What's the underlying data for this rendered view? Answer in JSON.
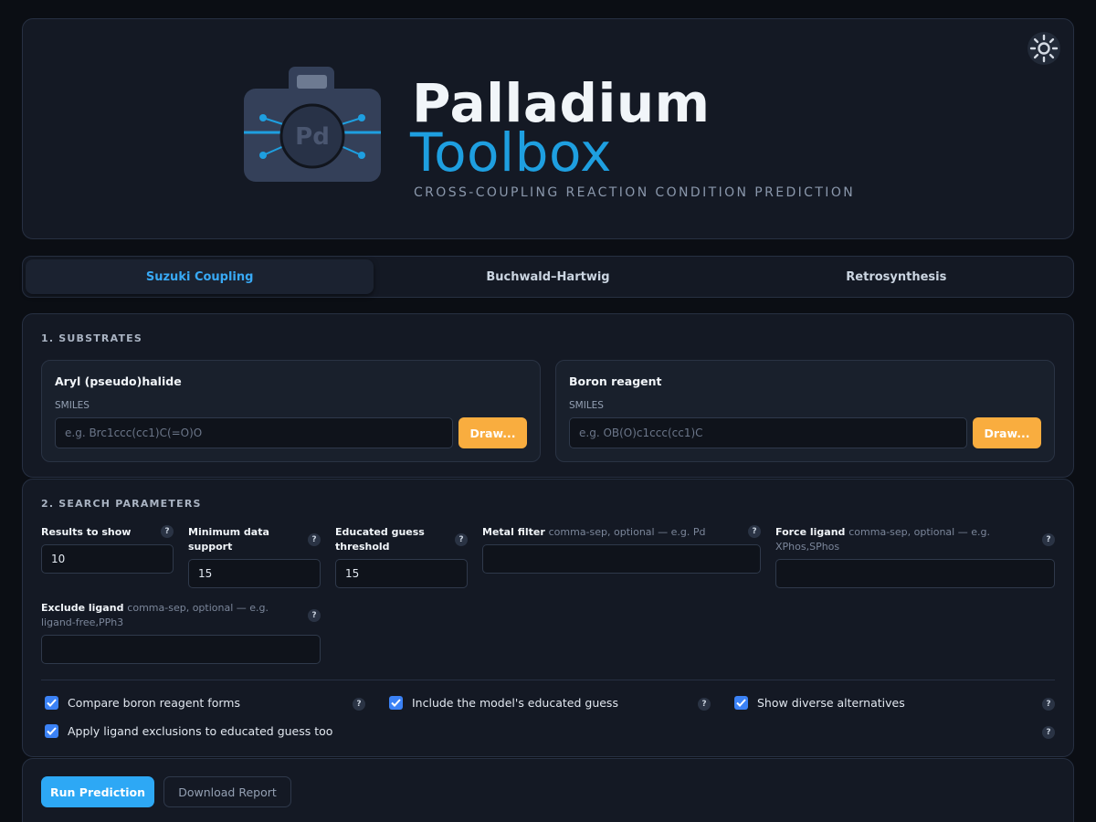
{
  "header": {
    "title_line1": "Palladium",
    "title_line2": "Toolbox",
    "subtitle": "CROSS-COUPLING REACTION CONDITION PREDICTION",
    "logo_text": "Pd",
    "theme_icon": "sun-icon"
  },
  "tabs": [
    {
      "label": "Suzuki Coupling",
      "active": true
    },
    {
      "label": "Buchwald–Hartwig",
      "active": false
    },
    {
      "label": "Retrosynthesis",
      "active": false
    }
  ],
  "substrates": {
    "title": "1. SUBSTRATES",
    "aryl": {
      "name": "Aryl (pseudo)halide",
      "smiles_label": "SMILES",
      "placeholder": "e.g. Brc1ccc(cc1)C(=O)O",
      "value": "",
      "draw_label": "Draw..."
    },
    "boron": {
      "name": "Boron reagent",
      "smiles_label": "SMILES",
      "placeholder": "e.g. OB(O)c1ccc(cc1)C",
      "value": "",
      "draw_label": "Draw..."
    }
  },
  "params": {
    "title": "2. SEARCH PARAMETERS",
    "results": {
      "label": "Results to show",
      "value": "10"
    },
    "min_support": {
      "label": "Minimum data support",
      "value": "15"
    },
    "threshold": {
      "label": "Educated guess threshold",
      "value": "15"
    },
    "metal": {
      "label": "Metal filter",
      "hint": "comma-sep, optional — e.g. Pd",
      "value": ""
    },
    "force_ligand": {
      "label": "Force ligand",
      "hint": "comma-sep, optional — e.g. XPhos,SPhos",
      "value": ""
    },
    "exclude_ligand": {
      "label": "Exclude ligand",
      "hint": "comma-sep, optional — e.g. ligand-free,PPh3",
      "value": ""
    },
    "help_glyph": "?",
    "checkboxes": [
      {
        "label": "Compare boron reagent forms",
        "checked": true
      },
      {
        "label": "Include the model's educated guess",
        "checked": true
      },
      {
        "label": "Show diverse alternatives",
        "checked": true
      },
      {
        "label": "Apply ligand exclusions to educated guess too",
        "checked": true
      }
    ]
  },
  "actions": {
    "run_label": "Run Prediction",
    "download_label": "Download Report"
  },
  "colors": {
    "accent_blue": "#1e9fe0",
    "draw_orange": "#f9ad3f",
    "checkbox_blue": "#3b82f6",
    "run_blue": "#2da8f5"
  }
}
